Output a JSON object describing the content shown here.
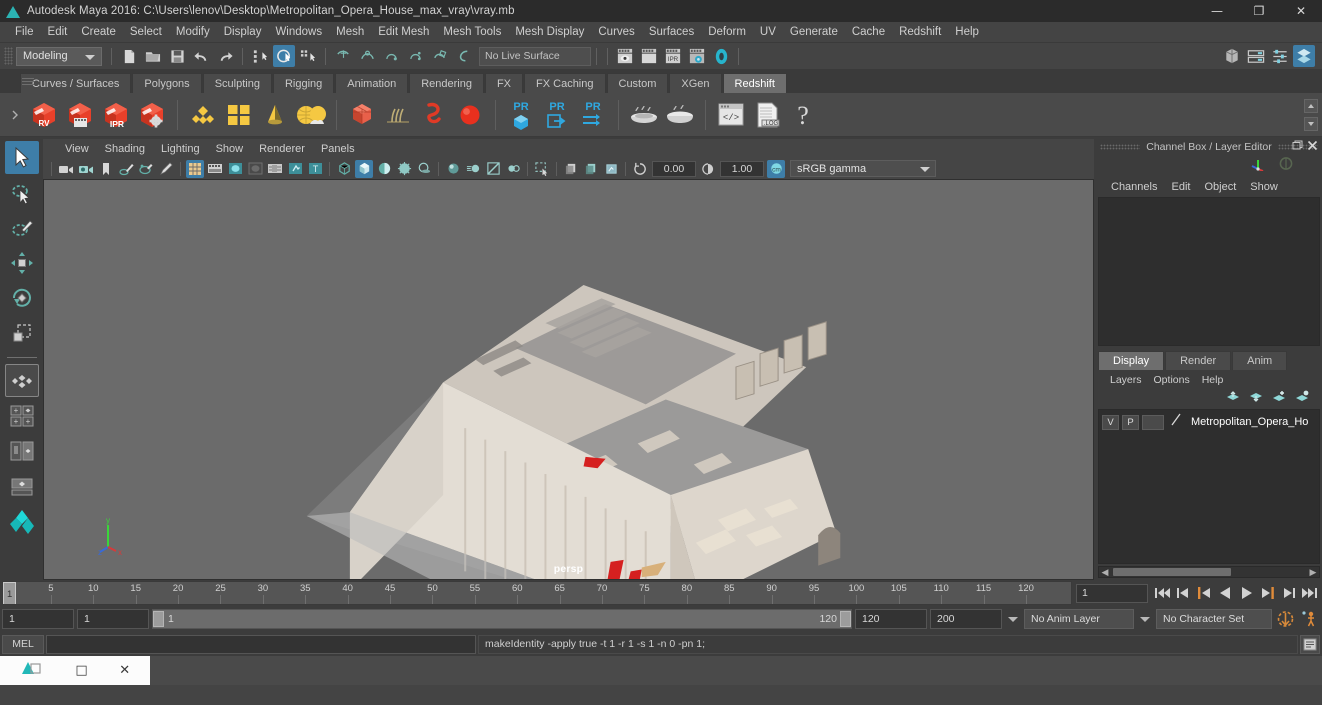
{
  "window": {
    "title": "Autodesk Maya 2016: C:\\Users\\lenov\\Desktop\\Metropolitan_Opera_House_max_vray\\vray.mb",
    "app_icon": "maya-logo-icon",
    "minimize": "—",
    "maximize": "❐",
    "close": "✕"
  },
  "menubar": {
    "items": [
      "File",
      "Edit",
      "Create",
      "Select",
      "Modify",
      "Display",
      "Windows",
      "Mesh",
      "Edit Mesh",
      "Mesh Tools",
      "Mesh Display",
      "Curves",
      "Surfaces",
      "Deform",
      "UV",
      "Generate",
      "Cache",
      "Redshift",
      "Help"
    ]
  },
  "statusline": {
    "mode": "Modeling",
    "live_surface": "No Live Surface",
    "buttons": [
      "new-scene-icon",
      "open-scene-icon",
      "save-scene-icon",
      "undo-icon",
      "redo-icon",
      "select-by-hierarchy-icon",
      "select-by-object-icon",
      "select-by-component-icon",
      "snap-to-grid-icon",
      "snap-to-curve-icon",
      "snap-to-point-icon",
      "snap-to-projected-center-icon",
      "snap-to-view-plane-icon",
      "make-live-icon"
    ],
    "render_buttons": [
      "render-current-frame-icon",
      "redo-previous-render-icon",
      "ipr-render-icon",
      "render-settings-icon",
      "render-view-icon"
    ],
    "right_buttons": [
      "show-hide-modeling-toolkit-icon",
      "show-hide-attribute-editor-icon",
      "show-hide-tool-settings-icon",
      "show-hide-channel-box-icon"
    ]
  },
  "shelf": {
    "tabs": [
      "Curves / Surfaces",
      "Polygons",
      "Sculpting",
      "Rigging",
      "Animation",
      "Rendering",
      "FX",
      "FX Caching",
      "Custom",
      "XGen",
      "Redshift"
    ],
    "selected_tab": "Redshift",
    "icons": [
      {
        "name": "redshift-render-view-icon",
        "label": "RV"
      },
      {
        "name": "redshift-render-sequence-icon",
        "label": ""
      },
      {
        "name": "redshift-ipr-icon",
        "label": "IPR"
      },
      {
        "name": "redshift-render-settings-icon",
        "label": ""
      },
      {
        "name": "redshift-material-icon",
        "label": ""
      },
      {
        "name": "redshift-tiles-icon",
        "label": ""
      },
      {
        "name": "redshift-light-cone-icon",
        "label": ""
      },
      {
        "name": "redshift-dome-light-icon",
        "label": ""
      },
      {
        "name": "redshift-proxy-icon",
        "label": ""
      },
      {
        "name": "redshift-hair-icon",
        "label": ""
      },
      {
        "name": "redshift-volume-icon",
        "label": ""
      },
      {
        "name": "redshift-sphere-icon",
        "label": ""
      },
      {
        "name": "redshift-pr-object-icon",
        "label": "PR"
      },
      {
        "name": "redshift-pr-export-icon",
        "label": "PR"
      },
      {
        "name": "redshift-pr-settings-icon",
        "label": "PR"
      },
      {
        "name": "redshift-bake-icon",
        "label": ""
      },
      {
        "name": "redshift-bake-all-icon",
        "label": ""
      },
      {
        "name": "redshift-script-icon",
        "label": ""
      },
      {
        "name": "redshift-log-icon",
        "label": ".LOG"
      },
      {
        "name": "redshift-help-icon",
        "label": "?"
      }
    ]
  },
  "toolbox": {
    "tools": [
      "select-tool",
      "lasso-select-tool",
      "paint-select-tool",
      "move-tool",
      "rotate-tool",
      "scale-tool",
      "last-tool-used",
      "four-view-layout",
      "two-by-two-layout",
      "persp-outliner-layout",
      "persp-graph-layout",
      "hypershade-layout"
    ],
    "selected": "select-tool"
  },
  "viewport": {
    "menus": [
      "View",
      "Shading",
      "Lighting",
      "Show",
      "Renderer",
      "Panels"
    ],
    "camera_label": "persp",
    "exposure": "0.00",
    "gamma": "1.00",
    "color_profile": "sRGB gamma",
    "toolbar_icons": [
      "select-camera-icon",
      "camera-attributes-icon",
      "bookmark-icon",
      "image-plane-icon",
      "two-d-pan-zoom-icon",
      "grease-pencil-icon",
      "grid-icon",
      "film-gate-icon",
      "resolution-gate-icon",
      "gate-mask-icon",
      "film-origin-icon",
      "exposure-icon",
      "safe-title-icon",
      "wireframe-icon",
      "smooth-shade-icon",
      "shaded-textured-icon",
      "use-all-lights-icon",
      "shadows-icon",
      "screen-space-ao-icon",
      "motion-blur-icon",
      "multisample-icon",
      "depth-of-field-icon",
      "isolate-select-icon",
      "xray-icon",
      "xray-joints-icon",
      "xray-active-icon",
      "exposure-reset-icon",
      "gamma-reset-icon",
      "color-management-icon"
    ]
  },
  "channelbox": {
    "title": "Channel Box / Layer Editor",
    "restore_icon": "restore-panel-icon",
    "close_icon": "close-panel-icon",
    "toolbar_icons": [
      "channel-box-icon",
      "attribute-editor-icon"
    ],
    "menus": [
      "Channels",
      "Edit",
      "Object",
      "Show"
    ]
  },
  "layereditor": {
    "tabs": [
      "Display",
      "Render",
      "Anim"
    ],
    "selected_tab": "Display",
    "menus": [
      "Layers",
      "Options",
      "Help"
    ],
    "toolbar_icons": [
      "move-layer-up-icon",
      "move-layer-down-icon",
      "new-layer-icon",
      "new-layer-from-selected-icon"
    ],
    "layers": [
      {
        "visibility": "V",
        "playback": "P",
        "type_swatch": "",
        "name": "Metropolitan_Opera_Ho"
      }
    ]
  },
  "timeline": {
    "current_frame": "1",
    "ticks": [
      5,
      10,
      15,
      20,
      25,
      30,
      35,
      40,
      45,
      50,
      55,
      60,
      65,
      70,
      75,
      80,
      85,
      90,
      95,
      100,
      105,
      110,
      115,
      120
    ],
    "playback_field": "1",
    "transport": [
      "go-to-start-icon",
      "step-back-keyframe-icon",
      "step-back-frame-icon",
      "play-backwards-icon",
      "play-forwards-icon",
      "step-forward-frame-icon",
      "step-forward-keyframe-icon",
      "go-to-end-icon"
    ]
  },
  "rangeslider": {
    "anim_start": "1",
    "range_start": "1",
    "slider_start_label": "1",
    "slider_end_label": "120",
    "range_end": "120",
    "anim_end": "200",
    "anim_layer": "No Anim Layer",
    "character_set": "No Character Set",
    "auto_key_icon": "auto-keyframe-icon",
    "anim_prefs_icon": "animation-preferences-icon"
  },
  "command": {
    "label": "MEL",
    "input_value": "",
    "output": "makeIdentity -apply true -t 1 -r 1 -s 1 -n 0 -pn 1;",
    "script_editor_icon": "script-editor-icon"
  },
  "taskbar": {
    "items": [
      "maya-taskbar-icon",
      "restore-window-icon",
      "close-window-icon"
    ]
  },
  "colors": {
    "accent": "#3e7ea8",
    "viewport_bg": "#6b6b6b",
    "panel_bg": "#3c3c3c",
    "toolbar_bg": "#4a4a4a",
    "redshift_red": "#e8402a",
    "text": "#cfcfcf"
  }
}
